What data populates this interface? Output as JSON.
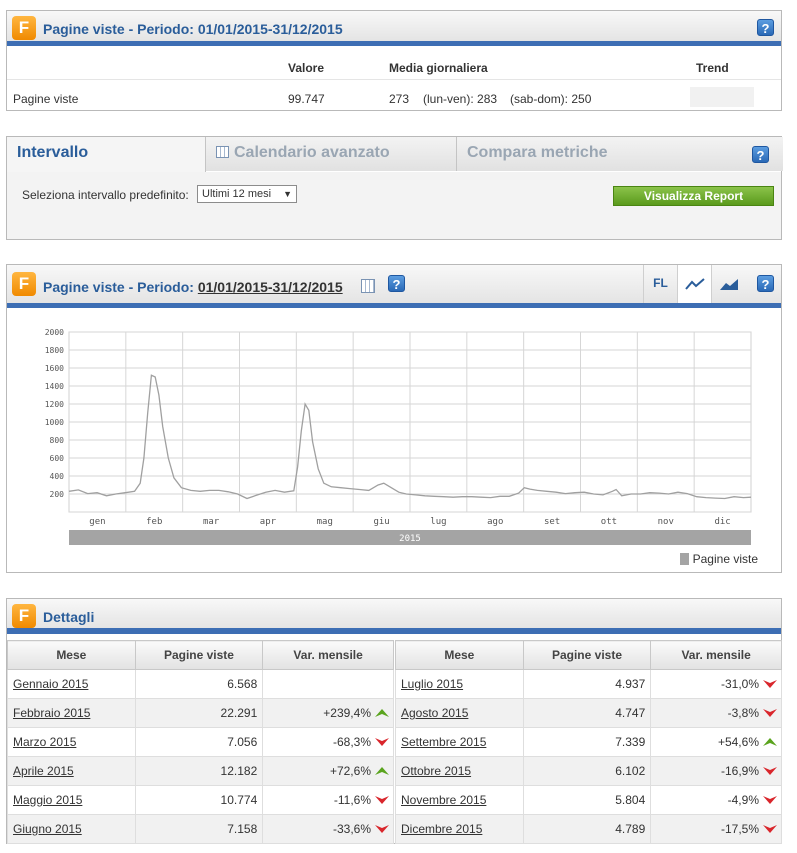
{
  "summary_panel": {
    "logo": "F",
    "title": "Pagine viste - Periodo: 01/01/2015-31/12/2015",
    "help": "?",
    "headers": {
      "valore": "Valore",
      "media": "Media giornaliera",
      "trend": "Trend"
    },
    "row": {
      "label": "Pagine viste",
      "valore": "99.747",
      "media": "273",
      "lun_ven": "(lun-ven): 283",
      "sab_dom": "(sab-dom): 250"
    }
  },
  "interval_panel": {
    "tabs": [
      {
        "label": "Intervallo",
        "active": true
      },
      {
        "label": "Calendario avanzato",
        "active": false
      },
      {
        "label": "Compara metriche",
        "active": false
      }
    ],
    "help": "?",
    "select_label": "Seleziona intervallo predefinito:",
    "select_value": "Ultimi 12 mesi",
    "button": "Visualizza Report"
  },
  "chart_panel": {
    "logo": "F",
    "title_prefix": "Pagine viste - Periodo: ",
    "title_period": "01/01/2015-31/12/2015",
    "help": "?",
    "tools": {
      "fl": "FL"
    },
    "legend": "Pagine viste",
    "year_label": "2015"
  },
  "chart_data": {
    "type": "line",
    "ylim": [
      0,
      2000
    ],
    "yticks": [
      0,
      200,
      400,
      600,
      800,
      1000,
      1200,
      1400,
      1600,
      1800,
      2000
    ],
    "ytick_labels": [
      "200",
      "400",
      "600",
      "800",
      "1000",
      "1200",
      "1400",
      "1600",
      "1800",
      "2000"
    ],
    "xtick_labels": [
      "gen",
      "feb",
      "mar",
      "apr",
      "mag",
      "giu",
      "lug",
      "ago",
      "set",
      "ott",
      "nov",
      "dic"
    ],
    "grid": true,
    "legend_position": "bottom-right",
    "series": [
      {
        "name": "Pagine viste",
        "color": "#a0a0a0",
        "points": [
          [
            0,
            230
          ],
          [
            5,
            245
          ],
          [
            10,
            205
          ],
          [
            15,
            215
          ],
          [
            20,
            180
          ],
          [
            25,
            200
          ],
          [
            30,
            215
          ],
          [
            35,
            230
          ],
          [
            38,
            320
          ],
          [
            40,
            600
          ],
          [
            42,
            1100
          ],
          [
            44,
            1520
          ],
          [
            46,
            1500
          ],
          [
            48,
            1300
          ],
          [
            50,
            950
          ],
          [
            53,
            600
          ],
          [
            56,
            380
          ],
          [
            60,
            270
          ],
          [
            65,
            240
          ],
          [
            70,
            230
          ],
          [
            75,
            240
          ],
          [
            80,
            240
          ],
          [
            85,
            225
          ],
          [
            90,
            200
          ],
          [
            95,
            150
          ],
          [
            100,
            185
          ],
          [
            105,
            220
          ],
          [
            110,
            240
          ],
          [
            115,
            220
          ],
          [
            120,
            235
          ],
          [
            122,
            500
          ],
          [
            124,
            900
          ],
          [
            126,
            1200
          ],
          [
            128,
            1130
          ],
          [
            130,
            780
          ],
          [
            133,
            480
          ],
          [
            136,
            320
          ],
          [
            140,
            280
          ],
          [
            145,
            270
          ],
          [
            150,
            260
          ],
          [
            155,
            250
          ],
          [
            160,
            240
          ],
          [
            165,
            300
          ],
          [
            168,
            320
          ],
          [
            172,
            270
          ],
          [
            176,
            220
          ],
          [
            180,
            200
          ],
          [
            185,
            190
          ],
          [
            190,
            180
          ],
          [
            195,
            175
          ],
          [
            200,
            170
          ],
          [
            205,
            165
          ],
          [
            210,
            170
          ],
          [
            215,
            170
          ],
          [
            220,
            165
          ],
          [
            225,
            160
          ],
          [
            230,
            175
          ],
          [
            235,
            175
          ],
          [
            240,
            210
          ],
          [
            243,
            270
          ],
          [
            246,
            255
          ],
          [
            250,
            240
          ],
          [
            255,
            230
          ],
          [
            260,
            220
          ],
          [
            265,
            205
          ],
          [
            270,
            215
          ],
          [
            275,
            220
          ],
          [
            280,
            200
          ],
          [
            285,
            190
          ],
          [
            290,
            230
          ],
          [
            292,
            250
          ],
          [
            295,
            180
          ],
          [
            300,
            200
          ],
          [
            305,
            200
          ],
          [
            310,
            215
          ],
          [
            315,
            210
          ],
          [
            320,
            200
          ],
          [
            325,
            220
          ],
          [
            330,
            205
          ],
          [
            335,
            170
          ],
          [
            340,
            160
          ],
          [
            345,
            155
          ],
          [
            350,
            150
          ],
          [
            355,
            170
          ],
          [
            360,
            160
          ],
          [
            364,
            165
          ]
        ]
      }
    ]
  },
  "details_panel": {
    "logo": "F",
    "title": "Dettagli",
    "headers": [
      "Mese",
      "Pagine viste",
      "Var. mensile"
    ],
    "left_rows": [
      {
        "mese": "Gennaio 2015",
        "pagine": "6.568",
        "var": "",
        "dir": ""
      },
      {
        "mese": "Febbraio 2015",
        "pagine": "22.291",
        "var": "+239,4%",
        "dir": "up"
      },
      {
        "mese": "Marzo 2015",
        "pagine": "7.056",
        "var": "-68,3%",
        "dir": "down"
      },
      {
        "mese": "Aprile 2015",
        "pagine": "12.182",
        "var": "+72,6%",
        "dir": "up"
      },
      {
        "mese": "Maggio 2015",
        "pagine": "10.774",
        "var": "-11,6%",
        "dir": "down"
      },
      {
        "mese": "Giugno 2015",
        "pagine": "7.158",
        "var": "-33,6%",
        "dir": "down"
      }
    ],
    "right_rows": [
      {
        "mese": "Luglio 2015",
        "pagine": "4.937",
        "var": "-31,0%",
        "dir": "down"
      },
      {
        "mese": "Agosto 2015",
        "pagine": "4.747",
        "var": "-3,8%",
        "dir": "down"
      },
      {
        "mese": "Settembre 2015",
        "pagine": "7.339",
        "var": "+54,6%",
        "dir": "up"
      },
      {
        "mese": "Ottobre 2015",
        "pagine": "6.102",
        "var": "-16,9%",
        "dir": "down"
      },
      {
        "mese": "Novembre 2015",
        "pagine": "5.804",
        "var": "-4,9%",
        "dir": "down"
      },
      {
        "mese": "Dicembre 2015",
        "pagine": "4.789",
        "var": "-17,5%",
        "dir": "down"
      }
    ],
    "colors": {
      "up": "#5aa41e",
      "down": "#d9262c"
    }
  }
}
